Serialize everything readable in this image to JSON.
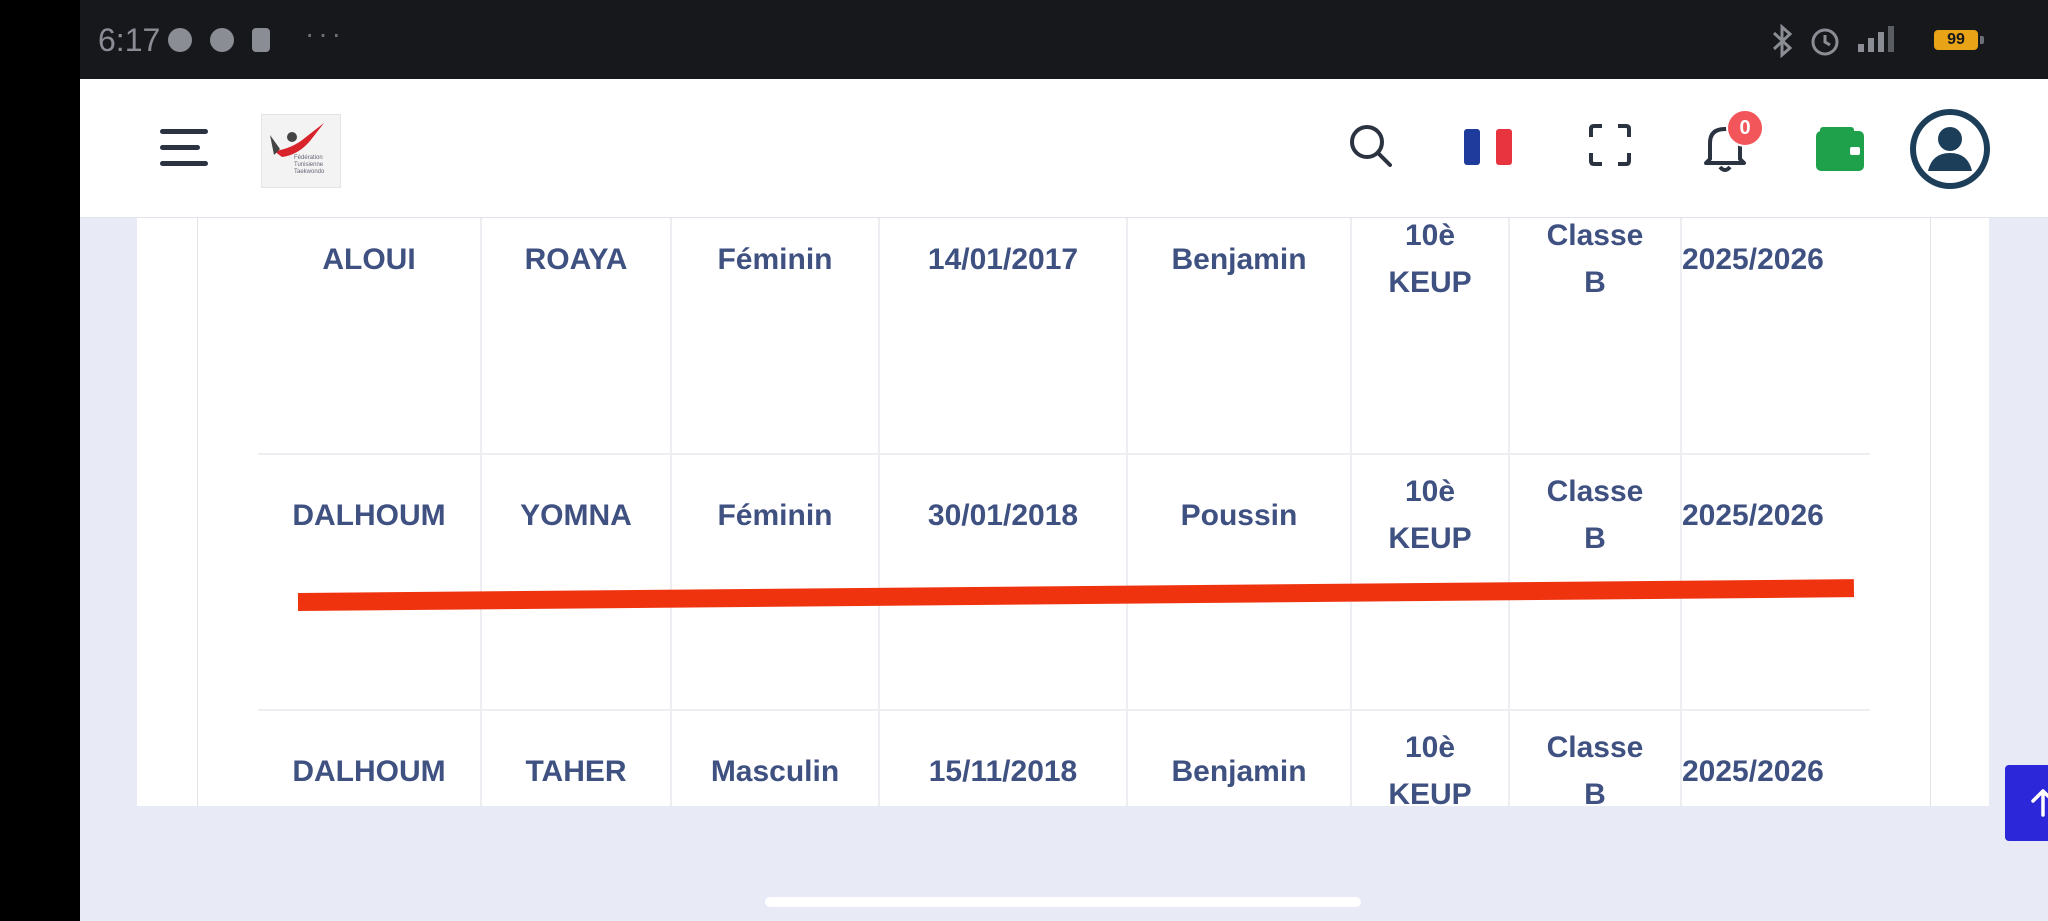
{
  "status_bar": {
    "time": "6:17",
    "battery": "99"
  },
  "header": {
    "logo_text": "Fédération Tunisienne Taekwondo",
    "notification_count": "0"
  },
  "table": {
    "rows": [
      {
        "nom": "ALOUI",
        "prenom": "ROAYA",
        "sexe": "Féminin",
        "date": "14/01/2017",
        "categorie": "Benjamin",
        "grade": "10è\nKEUP",
        "classe": "Classe\nB",
        "saison": "2025/2026"
      },
      {
        "nom": "DALHOUM",
        "prenom": "YOMNA",
        "sexe": "Féminin",
        "date": "30/01/2018",
        "categorie": "Poussin",
        "grade": "10è\nKEUP",
        "classe": "Classe\nB",
        "saison": "2025/2026"
      },
      {
        "nom": "DALHOUM",
        "prenom": "TAHER",
        "sexe": "Masculin",
        "date": "15/11/2018",
        "categorie": "Benjamin",
        "grade": "10è\nKEUP",
        "classe": "Classe\nB",
        "saison": "2025/2026"
      }
    ]
  },
  "colors": {
    "text": "#3f5181",
    "annotation": "#f0330f",
    "scroll_button": "#2c27d8",
    "badge": "#f2555a"
  },
  "icons": [
    "menu-icon",
    "search-icon",
    "french-flag-icon",
    "fullscreen-icon",
    "bell-icon",
    "wallet-icon",
    "user-avatar-icon",
    "arrow-up-icon"
  ]
}
